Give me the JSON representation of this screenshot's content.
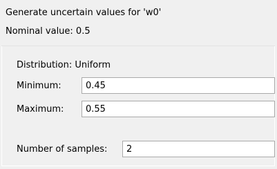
{
  "dialog": {
    "title_text": "Generate uncertain values for 'w0'",
    "nominal_text": "Nominal value: 0.5"
  },
  "form": {
    "distribution_text": "Distribution: Uniform",
    "minimum_label": "Minimum:",
    "minimum_value": "0.45",
    "maximum_label": "Maximum:",
    "maximum_value": "0.55",
    "samples_label": "Number of samples:",
    "samples_value": "2"
  },
  "colors": {
    "background": "#f0f0f0",
    "field_background": "#ffffff",
    "field_border": "#a9a9a9"
  }
}
